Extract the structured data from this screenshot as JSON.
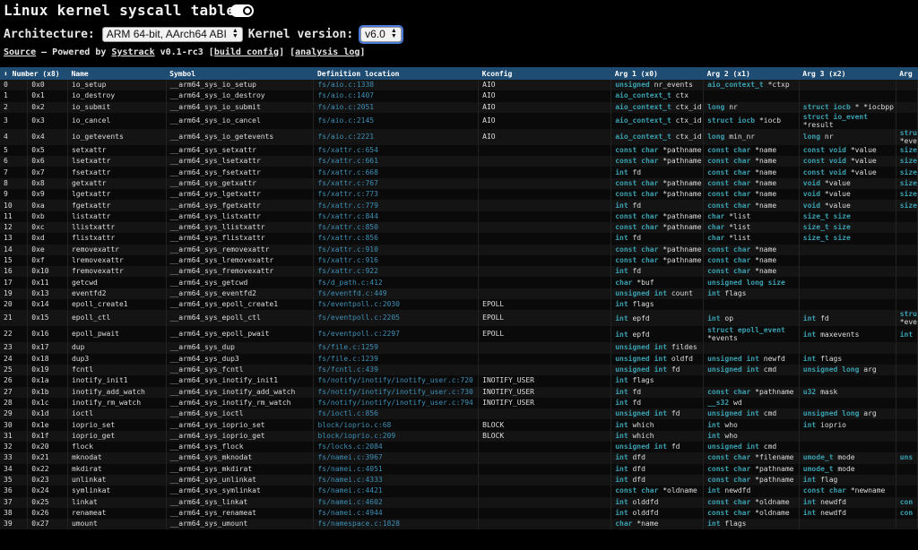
{
  "header": {
    "title": "Linux kernel syscall tables"
  },
  "controls": {
    "arch_label": "Architecture:",
    "arch_value": "ARM 64-bit, AArch64 ABI",
    "kernel_label": "Kernel version:",
    "kernel_value": "v6.0"
  },
  "links": {
    "source": "Source",
    "powered": " – Powered by ",
    "systrack": "Systrack",
    "version": " v0.1-rc3 [",
    "build_config": "build config",
    "mid": "] [",
    "analysis_log": "analysis log",
    "end": "]"
  },
  "table": {
    "headers": [
      "⬍ Number (x8)",
      "Name",
      "Symbol",
      "Definition location",
      "Kconfig",
      "Arg 1 (x0)",
      "Arg 2 (x1)",
      "Arg 3 (x2)",
      "Arg"
    ],
    "rows": [
      {
        "num": "0",
        "hex": "0x0",
        "name": "io_setup",
        "sym": "__arm64_sys_io_setup",
        "loc": "fs/aio.c:1338",
        "kconf": "AIO",
        "a1": "unsigned nr_events",
        "a2": "aio_context_t *ctxp",
        "a3": "",
        "a4": "",
        "tall": false
      },
      {
        "num": "1",
        "hex": "0x1",
        "name": "io_destroy",
        "sym": "__arm64_sys_io_destroy",
        "loc": "fs/aio.c:1407",
        "kconf": "AIO",
        "a1": "aio_context_t ctx",
        "a2": "",
        "a3": "",
        "a4": "",
        "tall": false
      },
      {
        "num": "2",
        "hex": "0x2",
        "name": "io_submit",
        "sym": "__arm64_sys_io_submit",
        "loc": "fs/aio.c:2051",
        "kconf": "AIO",
        "a1": "aio_context_t ctx_id",
        "a2": "long nr",
        "a3": "struct iocb * *iocbpp",
        "a4": "",
        "tall": false
      },
      {
        "num": "3",
        "hex": "0x3",
        "name": "io_cancel",
        "sym": "__arm64_sys_io_cancel",
        "loc": "fs/aio.c:2145",
        "kconf": "AIO",
        "a1": "aio_context_t ctx_id",
        "a2": "struct iocb *iocb",
        "a3": "struct io_event *result",
        "a4": "",
        "tall": true
      },
      {
        "num": "4",
        "hex": "0x4",
        "name": "io_getevents",
        "sym": "__arm64_sys_io_getevents",
        "loc": "fs/aio.c:2221",
        "kconf": "AIO",
        "a1": "aio_context_t ctx_id",
        "a2": "long min_nr",
        "a3": "long nr",
        "a4": "stru *eve",
        "tall": true
      },
      {
        "num": "5",
        "hex": "0x5",
        "name": "setxattr",
        "sym": "__arm64_sys_setxattr",
        "loc": "fs/xattr.c:654",
        "kconf": "",
        "a1": "const char *pathname",
        "a2": "const char *name",
        "a3": "const void *value",
        "a4": "size",
        "tall": false
      },
      {
        "num": "6",
        "hex": "0x6",
        "name": "lsetxattr",
        "sym": "__arm64_sys_lsetxattr",
        "loc": "fs/xattr.c:661",
        "kconf": "",
        "a1": "const char *pathname",
        "a2": "const char *name",
        "a3": "const void *value",
        "a4": "size",
        "tall": false
      },
      {
        "num": "7",
        "hex": "0x7",
        "name": "fsetxattr",
        "sym": "__arm64_sys_fsetxattr",
        "loc": "fs/xattr.c:668",
        "kconf": "",
        "a1": "int fd",
        "a2": "const char *name",
        "a3": "const void *value",
        "a4": "size",
        "tall": false
      },
      {
        "num": "8",
        "hex": "0x8",
        "name": "getxattr",
        "sym": "__arm64_sys_getxattr",
        "loc": "fs/xattr.c:767",
        "kconf": "",
        "a1": "const char *pathname",
        "a2": "const char *name",
        "a3": "void *value",
        "a4": "size",
        "tall": false
      },
      {
        "num": "9",
        "hex": "0x9",
        "name": "lgetxattr",
        "sym": "__arm64_sys_lgetxattr",
        "loc": "fs/xattr.c:773",
        "kconf": "",
        "a1": "const char *pathname",
        "a2": "const char *name",
        "a3": "void *value",
        "a4": "size",
        "tall": false
      },
      {
        "num": "10",
        "hex": "0xa",
        "name": "fgetxattr",
        "sym": "__arm64_sys_fgetxattr",
        "loc": "fs/xattr.c:779",
        "kconf": "",
        "a1": "int fd",
        "a2": "const char *name",
        "a3": "void *value",
        "a4": "size",
        "tall": false
      },
      {
        "num": "11",
        "hex": "0xb",
        "name": "listxattr",
        "sym": "__arm64_sys_listxattr",
        "loc": "fs/xattr.c:844",
        "kconf": "",
        "a1": "const char *pathname",
        "a2": "char *list",
        "a3": "size_t size",
        "a4": "",
        "tall": false
      },
      {
        "num": "12",
        "hex": "0xc",
        "name": "llistxattr",
        "sym": "__arm64_sys_llistxattr",
        "loc": "fs/xattr.c:850",
        "kconf": "",
        "a1": "const char *pathname",
        "a2": "char *list",
        "a3": "size_t size",
        "a4": "",
        "tall": false
      },
      {
        "num": "13",
        "hex": "0xd",
        "name": "flistxattr",
        "sym": "__arm64_sys_flistxattr",
        "loc": "fs/xattr.c:856",
        "kconf": "",
        "a1": "int fd",
        "a2": "char *list",
        "a3": "size_t size",
        "a4": "",
        "tall": false
      },
      {
        "num": "14",
        "hex": "0xe",
        "name": "removexattr",
        "sym": "__arm64_sys_removexattr",
        "loc": "fs/xattr.c:910",
        "kconf": "",
        "a1": "const char *pathname",
        "a2": "const char *name",
        "a3": "",
        "a4": "",
        "tall": false
      },
      {
        "num": "15",
        "hex": "0xf",
        "name": "lremovexattr",
        "sym": "__arm64_sys_lremovexattr",
        "loc": "fs/xattr.c:916",
        "kconf": "",
        "a1": "const char *pathname",
        "a2": "const char *name",
        "a3": "",
        "a4": "",
        "tall": false
      },
      {
        "num": "16",
        "hex": "0x10",
        "name": "fremovexattr",
        "sym": "__arm64_sys_fremovexattr",
        "loc": "fs/xattr.c:922",
        "kconf": "",
        "a1": "int fd",
        "a2": "const char *name",
        "a3": "",
        "a4": "",
        "tall": false
      },
      {
        "num": "17",
        "hex": "0x11",
        "name": "getcwd",
        "sym": "__arm64_sys_getcwd",
        "loc": "fs/d_path.c:412",
        "kconf": "",
        "a1": "char *buf",
        "a2": "unsigned long size",
        "a3": "",
        "a4": "",
        "tall": false
      },
      {
        "num": "19",
        "hex": "0x13",
        "name": "eventfd2",
        "sym": "__arm64_sys_eventfd2",
        "loc": "fs/eventfd.c:449",
        "kconf": "",
        "a1": "unsigned int count",
        "a2": "int flags",
        "a3": "",
        "a4": "",
        "tall": false
      },
      {
        "num": "20",
        "hex": "0x14",
        "name": "epoll_create1",
        "sym": "__arm64_sys_epoll_create1",
        "loc": "fs/eventpoll.c:2030",
        "kconf": "EPOLL",
        "a1": "int flags",
        "a2": "",
        "a3": "",
        "a4": "",
        "tall": false
      },
      {
        "num": "21",
        "hex": "0x15",
        "name": "epoll_ctl",
        "sym": "__arm64_sys_epoll_ctl",
        "loc": "fs/eventpoll.c:2205",
        "kconf": "EPOLL",
        "a1": "int epfd",
        "a2": "int op",
        "a3": "int fd",
        "a4": "stru *eve",
        "tall": true
      },
      {
        "num": "22",
        "hex": "0x16",
        "name": "epoll_pwait",
        "sym": "__arm64_sys_epoll_pwait",
        "loc": "fs/eventpoll.c:2297",
        "kconf": "EPOLL",
        "a1": "int epfd",
        "a2": "struct epoll_event *events",
        "a3": "int maxevents",
        "a4": "int",
        "tall": true
      },
      {
        "num": "23",
        "hex": "0x17",
        "name": "dup",
        "sym": "__arm64_sys_dup",
        "loc": "fs/file.c:1259",
        "kconf": "",
        "a1": "unsigned int fildes",
        "a2": "",
        "a3": "",
        "a4": "",
        "tall": false
      },
      {
        "num": "24",
        "hex": "0x18",
        "name": "dup3",
        "sym": "__arm64_sys_dup3",
        "loc": "fs/file.c:1239",
        "kconf": "",
        "a1": "unsigned int oldfd",
        "a2": "unsigned int newfd",
        "a3": "int flags",
        "a4": "",
        "tall": false
      },
      {
        "num": "25",
        "hex": "0x19",
        "name": "fcntl",
        "sym": "__arm64_sys_fcntl",
        "loc": "fs/fcntl.c:439",
        "kconf": "",
        "a1": "unsigned int fd",
        "a2": "unsigned int cmd",
        "a3": "unsigned long arg",
        "a4": "",
        "tall": false
      },
      {
        "num": "26",
        "hex": "0x1a",
        "name": "inotify_init1",
        "sym": "__arm64_sys_inotify_init1",
        "loc": "fs/notify/inotify/inotify_user.c:720",
        "kconf": "INOTIFY_USER",
        "a1": "int flags",
        "a2": "",
        "a3": "",
        "a4": "",
        "tall": false
      },
      {
        "num": "27",
        "hex": "0x1b",
        "name": "inotify_add_watch",
        "sym": "__arm64_sys_inotify_add_watch",
        "loc": "fs/notify/inotify/inotify_user.c:730",
        "kconf": "INOTIFY_USER",
        "a1": "int fd",
        "a2": "const char *pathname",
        "a3": "u32 mask",
        "a4": "",
        "tall": false
      },
      {
        "num": "28",
        "hex": "0x1c",
        "name": "inotify_rm_watch",
        "sym": "__arm64_sys_inotify_rm_watch",
        "loc": "fs/notify/inotify/inotify_user.c:794",
        "kconf": "INOTIFY_USER",
        "a1": "int fd",
        "a2": "__s32 wd",
        "a3": "",
        "a4": "",
        "tall": false
      },
      {
        "num": "29",
        "hex": "0x1d",
        "name": "ioctl",
        "sym": "__arm64_sys_ioctl",
        "loc": "fs/ioctl.c:856",
        "kconf": "",
        "a1": "unsigned int fd",
        "a2": "unsigned int cmd",
        "a3": "unsigned long arg",
        "a4": "",
        "tall": false
      },
      {
        "num": "30",
        "hex": "0x1e",
        "name": "ioprio_set",
        "sym": "__arm64_sys_ioprio_set",
        "loc": "block/ioprio.c:68",
        "kconf": "BLOCK",
        "a1": "int which",
        "a2": "int who",
        "a3": "int ioprio",
        "a4": "",
        "tall": false
      },
      {
        "num": "31",
        "hex": "0x1f",
        "name": "ioprio_get",
        "sym": "__arm64_sys_ioprio_get",
        "loc": "block/ioprio.c:209",
        "kconf": "BLOCK",
        "a1": "int which",
        "a2": "int who",
        "a3": "",
        "a4": "",
        "tall": false
      },
      {
        "num": "32",
        "hex": "0x20",
        "name": "flock",
        "sym": "__arm64_sys_flock",
        "loc": "fs/locks.c:2084",
        "kconf": "",
        "a1": "unsigned int fd",
        "a2": "unsigned int cmd",
        "a3": "",
        "a4": "",
        "tall": false
      },
      {
        "num": "33",
        "hex": "0x21",
        "name": "mknodat",
        "sym": "__arm64_sys_mknodat",
        "loc": "fs/namei.c:3967",
        "kconf": "",
        "a1": "int dfd",
        "a2": "const char *filename",
        "a3": "umode_t mode",
        "a4": "uns",
        "tall": false
      },
      {
        "num": "34",
        "hex": "0x22",
        "name": "mkdirat",
        "sym": "__arm64_sys_mkdirat",
        "loc": "fs/namei.c:4051",
        "kconf": "",
        "a1": "int dfd",
        "a2": "const char *pathname",
        "a3": "umode_t mode",
        "a4": "",
        "tall": false
      },
      {
        "num": "35",
        "hex": "0x23",
        "name": "unlinkat",
        "sym": "__arm64_sys_unlinkat",
        "loc": "fs/namei.c:4333",
        "kconf": "",
        "a1": "int dfd",
        "a2": "const char *pathname",
        "a3": "int flag",
        "a4": "",
        "tall": false
      },
      {
        "num": "36",
        "hex": "0x24",
        "name": "symlinkat",
        "sym": "__arm64_sys_symlinkat",
        "loc": "fs/namei.c:4421",
        "kconf": "",
        "a1": "const char *oldname",
        "a2": "int newdfd",
        "a3": "const char *newname",
        "a4": "",
        "tall": false
      },
      {
        "num": "37",
        "hex": "0x25",
        "name": "linkat",
        "sym": "__arm64_sys_linkat",
        "loc": "fs/namei.c:4602",
        "kconf": "",
        "a1": "int olddfd",
        "a2": "const char *oldname",
        "a3": "int newdfd",
        "a4": "con",
        "tall": false
      },
      {
        "num": "38",
        "hex": "0x26",
        "name": "renameat",
        "sym": "__arm64_sys_renameat",
        "loc": "fs/namei.c:4944",
        "kconf": "",
        "a1": "int olddfd",
        "a2": "const char *oldname",
        "a3": "int newdfd",
        "a4": "con",
        "tall": false
      },
      {
        "num": "39",
        "hex": "0x27",
        "name": "umount",
        "sym": "__arm64_sys_umount",
        "loc": "fs/namespace.c:1828",
        "kconf": "",
        "a1": "char *name",
        "a2": "int flags",
        "a3": "",
        "a4": "",
        "tall": false
      }
    ]
  }
}
